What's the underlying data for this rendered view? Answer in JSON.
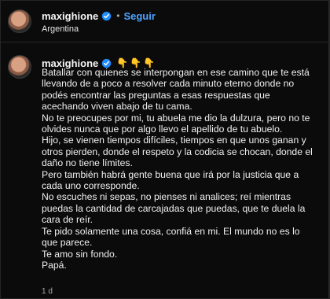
{
  "post": {
    "username": "maxighione",
    "follow_label": "Seguir",
    "location": "Argentina"
  },
  "comment": {
    "username": "maxighione",
    "emojis": [
      "👇",
      "👇",
      "👇"
    ],
    "paragraphs": [
      "Batallar con quienes se interpongan en ese camino que te está llevando de a poco a resolver cada minuto eterno donde no podés encontrar las preguntas a esas respuestas que acechando viven abajo de tu cama.",
      "No te preocupes por mi, tu abuela me dio la dulzura, pero no te olvides nunca que por algo llevo el apellido de tu abuelo.",
      "Hijo, se vienen tiempos difíciles, tiempos en que unos ganan y otros pierden, donde el respeto y la codicia se chocan, donde el daño no tiene límites.",
      "Pero también habrá gente buena que irá por la justicia que a cada uno corresponde.",
      "No escuches ni sepas, no pienses ni analices; reí mientras puedas la cantidad de carcajadas que puedas, que te duela la cara de reír.",
      "Te pido solamente una cosa, confiá en mi. El mundo no es lo que parece.",
      "Te amo sin fondo.",
      "Papá."
    ],
    "time": "1 d"
  },
  "colors": {
    "background": "#0b0b0b",
    "text": "#f5f5f5",
    "muted": "#a8a8a8",
    "accent": "#4fa3ff",
    "verified": "#1f8cff"
  },
  "icons": {
    "verified": "verified-badge-icon"
  }
}
